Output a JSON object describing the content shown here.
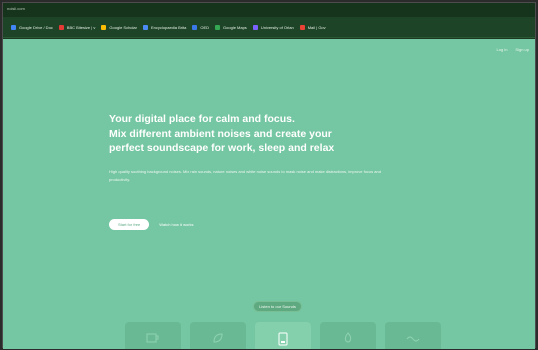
{
  "browser": {
    "title": "noisli.com",
    "bookmarks": [
      {
        "label": "Google Drive / Doc",
        "color": "#4285f4"
      },
      {
        "label": "BBC Bitesize | v",
        "color": "#e53935"
      },
      {
        "label": "Google Scholar",
        "color": "#fbbc05"
      },
      {
        "label": "Encyclopaedia Brita",
        "color": "#4c8bf5"
      },
      {
        "label": "OED",
        "color": "#3b78e7"
      },
      {
        "label": "Google Maps",
        "color": "#34a853"
      },
      {
        "label": "University of Orlan",
        "color": "#7b61ff"
      },
      {
        "label": "Mail | Gov",
        "color": "#ea4335"
      }
    ]
  },
  "nav": {
    "login": "Log in",
    "signup": "Sign up"
  },
  "hero": {
    "headline_line1": "Your digital place for calm and focus.",
    "headline_line2": "Mix different ambient noises and create your",
    "headline_line3": "perfect soundscape for work, sleep and relax",
    "subtext": "High quality soothing background noises. Mix rain sounds, nature noises and white noise sounds to mask noise and make distractions, improve focus and productivity."
  },
  "cta": {
    "primary": "Start for free",
    "secondary": "Watch how it works"
  },
  "sounds_button": "Listen to our Sounds",
  "tiles": [
    {
      "icon": "coffee-cup-icon",
      "active": false
    },
    {
      "icon": "leaf-icon",
      "active": false
    },
    {
      "icon": "phone-icon",
      "active": true
    },
    {
      "icon": "flame-icon",
      "active": false
    },
    {
      "icon": "wave-icon",
      "active": false
    }
  ]
}
